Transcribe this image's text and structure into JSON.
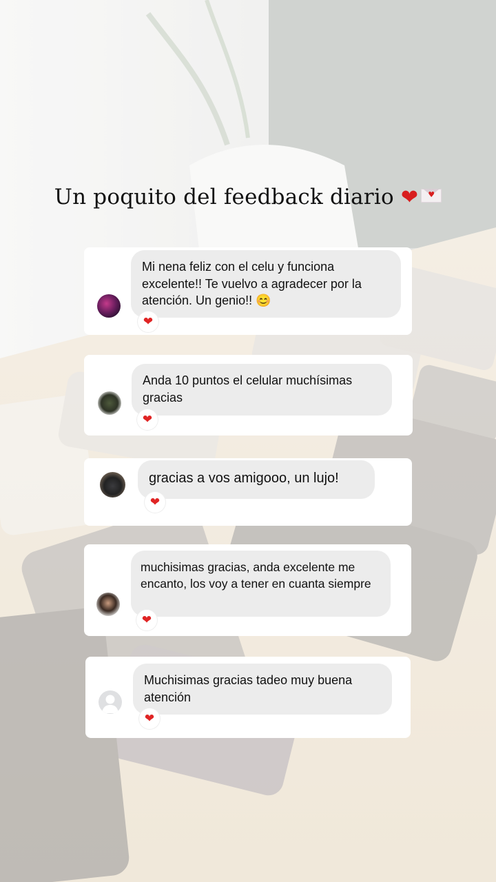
{
  "story_title": "Un poquito del feedback diario",
  "title_emoji_heart": "❤",
  "messages": [
    {
      "text": "Mi nena feliz con el celu y funciona excelente!! Te vuelvo a agradecer por la atención. Un genio!!",
      "emoji": "😊",
      "reaction": "❤"
    },
    {
      "text": "Anda 10 puntos el celular muchísimas gracias",
      "reaction": "❤"
    },
    {
      "text": "gracias a vos amigooo, un lujo!",
      "reaction": "❤"
    },
    {
      "text": "muchisimas gracias, anda excelente me encanto, los voy a tener en cuanta siempre",
      "reaction": "❤"
    },
    {
      "text": "Muchisimas gracias tadeo muy buena atención",
      "reaction": "❤"
    }
  ],
  "colors": {
    "heart": "#d81e1e",
    "bubble": "#ececec",
    "card": "#ffffff"
  }
}
